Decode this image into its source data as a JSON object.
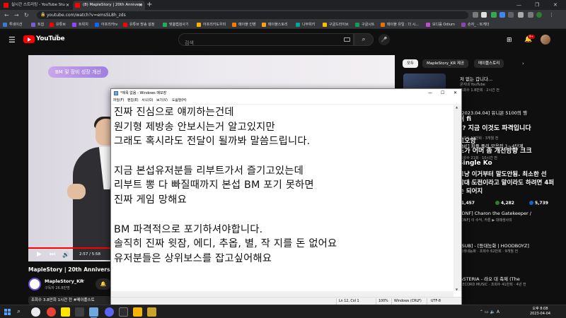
{
  "browser": {
    "tabs": [
      {
        "title": "실시간 스트리밍 - YouTube Stu",
        "active": false
      },
      {
        "title": "(8) MapleStory | 20th Annivers",
        "active": true
      }
    ],
    "url": "youtube.com/watch?v=emsSL8h_zds",
    "bookmarks": [
      "투네이션",
      "트윕",
      "유튜브",
      "트위치",
      "아프리카tv",
      "유튜브 방송 설정",
      "맞춤법검사기",
      "아프리카도우미",
      "메이플 인벤",
      "메이플스토리",
      "나무위키",
      "구글드라이브",
      "구글시트",
      "메이플 유틸 : 더 시...",
      "모디움 Odium",
      "숀자_ - 트게더"
    ]
  },
  "youtube": {
    "logo_text": "YouTube",
    "region": "KR",
    "search_placeholder": "검색",
    "notification_count": "9+",
    "video": {
      "badge": "BM 및 장비 성장 개선",
      "time": "2:57 / 5:58",
      "progress": 0.495,
      "title": "MapleStory | 20th Anniversar",
      "channel": "MapleStory_KR",
      "subs": "구독자 26.8만명",
      "desc": "조회수 3.8만회  1시간 전  #메이플스토"
    },
    "chips": [
      "모두",
      "MapleStory_KR 제공",
      "메이플스토리"
    ],
    "recs": [
      {
        "title": "저 없는 갑니다...",
        "meta": "굳지네 YouTube · 조회수 1.8만회 · 2시간 전"
      },
      {
        "title": "[DNF] Charon the Gatekeeper /",
        "meta": "[DNF] 이 수익, 카툰 ▶ 대때생사의"
      },
      {
        "title": "[SUB] - [등대능화 | HOODBOYZ]",
        "meta": "기레네능화 · 조회수 62만회 · 9개월 전"
      },
      {
        "title": "ASTERIA - 라오 대 축제 (The",
        "meta": "RECORD MUSIC · 조회수 41만회 · 4년 전"
      }
    ],
    "rec_extra": [
      "굳지네 YouTube",
      "조회수 1.8만회 · 2시간 전",
      "[2023.04.04] 유니온 5100의 행",
      "조회수 19만회 · 3개월 전",
      "[NF] 피플 플리 모음집 1~4단계",
      "조회수 21회 · 10시간 전",
      "굳지네 YouTube"
    ],
    "live_chat": [
      {
        "text": "쉬 fi",
        "icon": true
      },
      {
        "text": "?? 지금 이것도 파격입니다",
        "icon": false
      },
      {
        "text": "그오앙",
        "icon": true
      },
      {
        "text": "도가 어머 좀 개선방향 크크",
        "icon": false
      },
      {
        "text": "Single Ko",
        "icon": true
      },
      {
        "text": "그냥 이거부터 말도안됨. 최소한 선",
        "icon": false
      },
      {
        "text": "발대 도전이라고 말이라도 하려면 4퍼",
        "icon": false
      },
      {
        "text": "는 되어지",
        "icon": false
      }
    ],
    "stats": [
      "1,457",
      "4,282",
      "5,739"
    ]
  },
  "notepad": {
    "title": "*제목 없음 - Windows 메모장",
    "menus": [
      "파일(F)",
      "편집(E)",
      "서식(O)",
      "보기(V)",
      "도움말(H)"
    ],
    "lines": [
      "진짜 진심으로 얘끼하는건데",
      "원기형 제방송 안보시는거 알고있지만",
      "그래도 혹시라도 전달이 될까봐 말씀드립니다.",
      "",
      "지금 본섭유저분들 리부트가서 즐기고있는데",
      "리부트 뽕 다 빠질때까지 본섭 BM 포기 못하면",
      "진짜 게임 망해요",
      "",
      "BM 파격적으로 포기하셔야합니다.",
      "솔직히 진짜 윗잠, 에디, 추옵, 별, 작 지를 돈 없어요",
      "유저분들은 상위보스를 잡고싶어해요"
    ],
    "status": {
      "position": "Ln 12, Col 1",
      "zoom": "100%",
      "eol": "Windows (CRLF)",
      "encoding": "UTF-8"
    }
  },
  "taskbar": {
    "time": "오후 8:08",
    "date": "2023-04-04"
  }
}
